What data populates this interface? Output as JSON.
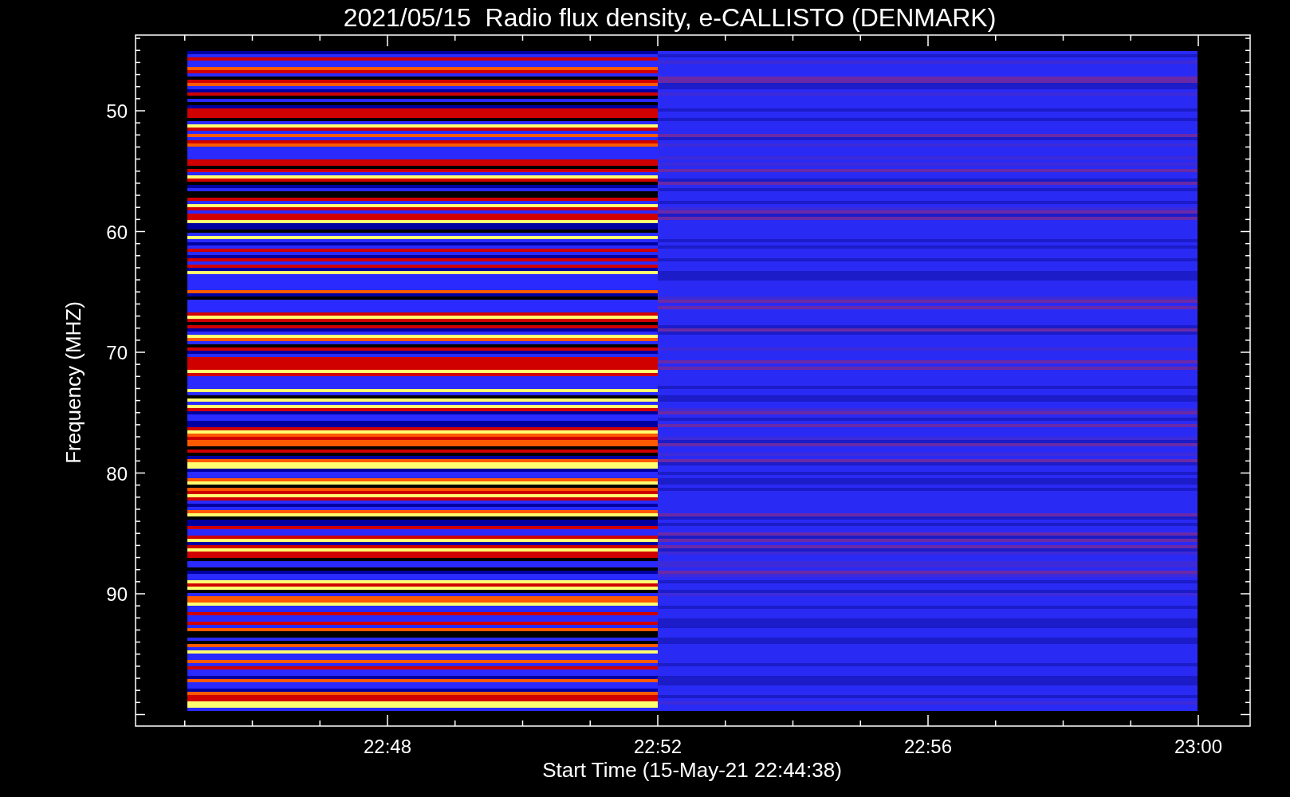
{
  "title": "2021/05/15  Radio flux density, e-CALLISTO (DENMARK)",
  "y_axis": {
    "label": "Frequency (MHZ)",
    "ticks": [
      "50",
      "60",
      "70",
      "80",
      "90"
    ]
  },
  "x_axis": {
    "label": "Start Time (15-May-21 22:44:38)",
    "ticks": [
      "22:48",
      "22:52",
      "22:56",
      "23:00"
    ]
  }
}
